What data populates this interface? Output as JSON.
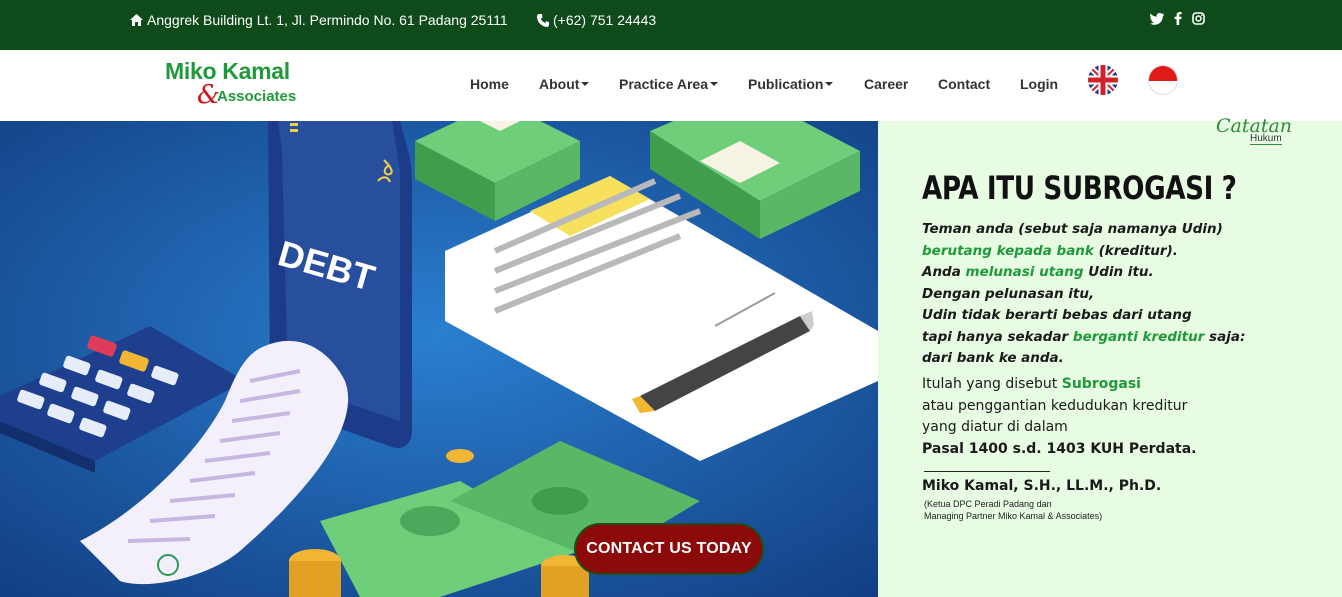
{
  "topbar": {
    "address": "Anggrek Building Lt. 1, Jl. Permindo No. 61 Padang 25111",
    "phone": "(+62) 751 24443",
    "social": [
      "twitter-icon",
      "facebook-icon",
      "instagram-icon"
    ]
  },
  "logo": {
    "line1": "Miko Kamal",
    "ampersand": "&",
    "line2": "Associates"
  },
  "nav": {
    "home": "Home",
    "about": "About",
    "practice": "Practice Area",
    "publication": "Publication",
    "career": "Career",
    "contact": "Contact",
    "login": "Login"
  },
  "hero": {
    "debt_text": "DEBT",
    "cta": "CONTACT US TODAY"
  },
  "panel": {
    "brand_top": "Catatan",
    "brand_sub": "Hukum",
    "title": "APA ITU SUBROGASI ?",
    "p1": {
      "l1": "Teman anda (sebut saja namanya Udin)",
      "l2_green": "berutang kepada bank",
      "l2_rest": " (kreditur).",
      "l3_pre": "Anda ",
      "l3_green": "melunasi utang",
      "l3_post": " Udin itu.",
      "l4": "Dengan pelunasan itu,",
      "l5": "Udin tidak berarti bebas dari utang",
      "l6_pre": "tapi hanya sekadar ",
      "l6_green": "berganti kreditur",
      "l6_post": " saja:",
      "l7": "dari bank ke anda."
    },
    "p2": {
      "l1_pre": "Itulah yang disebut ",
      "l1_green": "Subrogasi",
      "l2": "atau penggantian kedudukan kreditur",
      "l3": "yang diatur di dalam",
      "l4": "Pasal 1400 s.d. 1403 KUH Perdata."
    },
    "signature": "Miko Kamal, S.H., LL.M., Ph.D.",
    "sig_sub1": "(Ketua DPC Peradi Padang dan",
    "sig_sub2": "Managing Partner Miko Kamal & Associates)"
  },
  "colors": {
    "topbar": "#0f4a1a",
    "brand_green": "#1f9a3a",
    "cta_bg": "#8c0a0a",
    "panel_bg": "#e8fbe3"
  }
}
